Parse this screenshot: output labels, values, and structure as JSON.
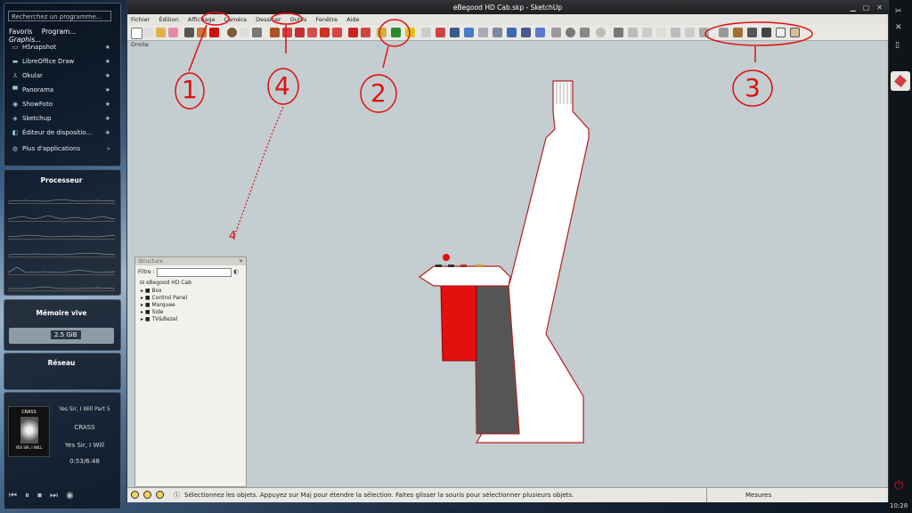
{
  "launcher": {
    "search_placeholder": "Recherchez un programme...",
    "tabs": [
      "Favoris",
      "Program...",
      "Graphis..."
    ],
    "apps": [
      {
        "icon": "screenshot-icon",
        "label": "HSnapshot"
      },
      {
        "icon": "draw-icon",
        "label": "LibreOffice Draw"
      },
      {
        "icon": "okular-icon",
        "label": "Okular"
      },
      {
        "icon": "panorama-icon",
        "label": "Panorama"
      },
      {
        "icon": "photo-icon",
        "label": "ShowFoto"
      },
      {
        "icon": "sketchup-icon",
        "label": "Sketchup"
      },
      {
        "icon": "editor-icon",
        "label": "Éditeur de dispositio..."
      },
      {
        "icon": "more-icon",
        "label": "Plus d'applications"
      }
    ]
  },
  "widgets": {
    "cpu_title": "Processeur",
    "mem_title": "Mémoire vive",
    "mem_value": "2.5 GiB",
    "net_title": "Réseau"
  },
  "player": {
    "track_title": "Yes Sir, I Will Part 5",
    "artist": "CRASS",
    "album": "Yes Sir, I Will",
    "time": "0:53/6:48",
    "cover_text_top": "CRASS",
    "cover_text_bottom": "YES SIR, I WILL"
  },
  "window": {
    "title": "eBegood HD Cab.skp - SketchUp",
    "menus": [
      "Fichier",
      "Édition",
      "Affichage",
      "Caméra",
      "Dessiner",
      "Outils",
      "Fenêtre",
      "Aide"
    ],
    "view_label": "Droite",
    "status_text": "Sélectionnez les objets. Appuyez sur Maj pour étendre la sélection. Faites glisser la souris pour sélectionner plusieurs objets.",
    "measures_label": "Mesures"
  },
  "outliner": {
    "title": "Structure",
    "filter_label": "Filtre :",
    "root": "eBegood HD Cab",
    "items": [
      "Box",
      "Control Panel",
      "Marquee",
      "Side",
      "TV&Bezel"
    ]
  },
  "clock": "10:28",
  "annotations": [
    "1",
    "2",
    "3",
    "4",
    "4"
  ]
}
